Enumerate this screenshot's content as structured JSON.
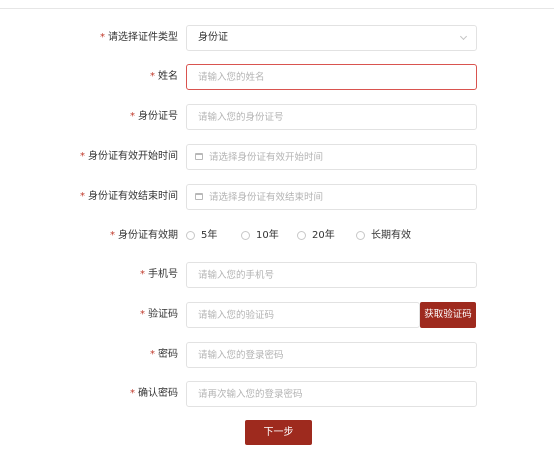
{
  "colors": {
    "accent": "#9e2a1e",
    "required": "#c0392b",
    "error_border": "#d9534f"
  },
  "form": {
    "required_mark": "*",
    "id_type": {
      "label": "请选择证件类型",
      "value": "身份证",
      "icon": "chevron-down-icon"
    },
    "name": {
      "label": "姓名",
      "placeholder": "请输入您的姓名"
    },
    "id_number": {
      "label": "身份证号",
      "placeholder": "请输入您的身份证号"
    },
    "start_date": {
      "label": "身份证有效开始时间",
      "placeholder": "请选择身份证有效开始时间",
      "icon": "calendar-icon"
    },
    "end_date": {
      "label": "身份证有效结束时间",
      "placeholder": "请选择身份证有效结束时间",
      "icon": "calendar-icon"
    },
    "validity": {
      "label": "身份证有效期",
      "options": [
        "5年",
        "10年",
        "20年",
        "长期有效"
      ]
    },
    "phone": {
      "label": "手机号",
      "placeholder": "请输入您的手机号"
    },
    "code": {
      "label": "验证码",
      "placeholder": "请输入您的验证码",
      "button": "获取验证码"
    },
    "password": {
      "label": "密码",
      "placeholder": "请输入您的登录密码"
    },
    "confirm_password": {
      "label": "确认密码",
      "placeholder": "请再次输入您的登录密码"
    },
    "next_button": "下一步"
  }
}
